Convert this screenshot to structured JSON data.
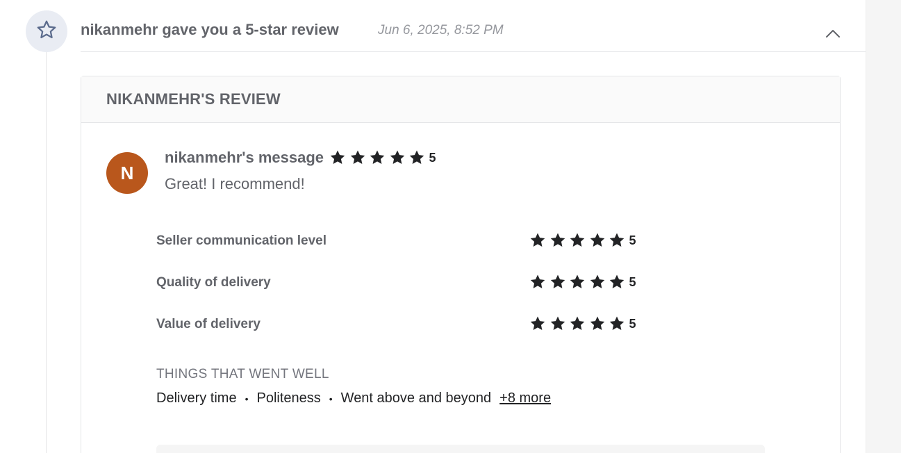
{
  "event": {
    "title": "nikanmehr gave you a 5-star review",
    "date": "Jun 6, 2025, 8:52 PM",
    "icon": "star-outline-icon"
  },
  "review": {
    "header_title": "NIKANMEHR'S REVIEW",
    "avatar_letter": "N",
    "avatar_color": "#b9571c",
    "author_label": "nikanmehr's message",
    "overall_rating": "5",
    "message": "Great! I recommend!",
    "criteria": [
      {
        "label": "Seller communication level",
        "rating": "5"
      },
      {
        "label": "Quality of delivery",
        "rating": "5"
      },
      {
        "label": "Value of delivery",
        "rating": "5"
      }
    ],
    "went_well_title": "THINGS THAT WENT WELL",
    "went_well_items": [
      "Delivery time",
      "Politeness",
      "Went above and beyond"
    ],
    "separator": "•",
    "more_label": "+8 more"
  },
  "colors": {
    "star": "#222325",
    "icon_bg": "#e9ecf3",
    "icon_stroke": "#5b6b8c"
  }
}
